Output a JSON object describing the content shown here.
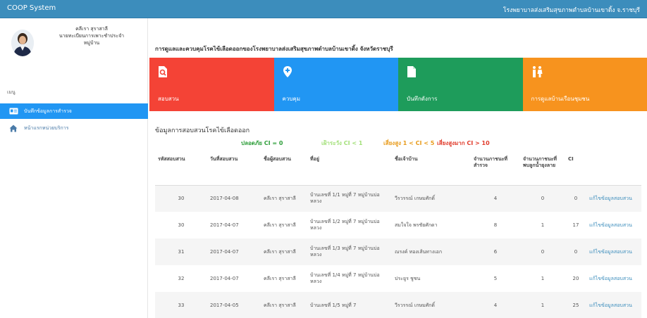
{
  "topbar": {
    "brand": "COOP System",
    "org_name": "โรงพยาบาลส่งเสริมสุขภาพตำบลบ้านเขาดิ้ง จ.ราชบุรี"
  },
  "sidebar": {
    "user": {
      "name": "คลีเรา สุราสาลี",
      "role_line1": "นายทะเบียนการเพาะชำประจำ",
      "role_line2": "หมู่บ้าน"
    },
    "menu_header": "เมนู",
    "items": [
      {
        "label": "บันทึกข้อมูลการสำรวจ",
        "icon": "id-card-icon",
        "active": true
      },
      {
        "label": "หน้าแรกหน่วยบริการ",
        "icon": "home-icon",
        "active": false
      }
    ]
  },
  "main": {
    "page_title": "การดูแลและควบคุมโรคไข้เลือดออกของโรงพยาบาลส่งเสริมสุขภาพตำบลบ้านเขาดิ้ง จังหวัดราชบุรี",
    "cards": [
      {
        "label": "สอบสวน",
        "color": "#f44336",
        "icon": "search-document-icon"
      },
      {
        "label": "ควบคุม",
        "color": "#2196f3",
        "icon": "map-pin-plus-icon"
      },
      {
        "label": "บันทึกดังการ",
        "color": "#1e9c5b",
        "icon": "document-icon"
      },
      {
        "label": "การดูแลบ้านเรือนชุมชน",
        "color": "#f7931e",
        "icon": "people-icon"
      }
    ],
    "section_title": "ข้อมูลการสอบสวนโรคไข้เลือดออก",
    "legend": [
      {
        "text": "ปลอดภัย CI = 0",
        "color": "#2e9e3a"
      },
      {
        "text": "เฝ้าระวัง CI < 1",
        "color": "#a3e07a"
      },
      {
        "text": "เสี่ยงสูง 1 < CI < 5",
        "color": "#e89b1a"
      },
      {
        "text": "เสี่ยงสูงมาก CI > 10",
        "color": "#e03a2a"
      }
    ],
    "table": {
      "headers": [
        "รหัสสอบสวน",
        "วันที่สอบสวน",
        "ชื่อผู้สอบสวน",
        "ที่อยู่",
        "ชื่อเจ้าบ้าน",
        "จำนวนภาชนะที่สำรวจ",
        "จำนวนภาชนะที่พบลูกน้ำยุงลาย",
        "CI",
        ""
      ],
      "rows": [
        [
          "30",
          "2017-04-08",
          "คลีเรา สุราสาลี",
          "บ้านเลขที่ 1/1 หมู่ที่ 7 หมู่บ้านบ่อหลวง",
          "วีรวรรณ์ เกษมศักดิ์",
          "4",
          "0",
          "0",
          "แก้ไขข้อมูลสอบสวน"
        ],
        [
          "30",
          "2017-04-07",
          "คลีเรา สุราสาลี",
          "บ้านเลขที่ 1/2 หมู่ที่ 7 หมู่บ้านบ่อหลวง",
          "สมใจใจ พรชัยศักดา",
          "8",
          "1",
          "17",
          "แก้ไขข้อมูลสอบสวน"
        ],
        [
          "31",
          "2017-04-07",
          "คลีเรา สุราสาลี",
          "บ้านเลขที่ 1/3 หมู่ที่ 7 หมู่บ้านบ่อหลวง",
          "ณรงค์ ทองเส้นทางเอก",
          "6",
          "0",
          "0",
          "แก้ไขข้อมูลสอบสวน"
        ],
        [
          "32",
          "2017-04-07",
          "คลีเรา สุราสาลี",
          "บ้านเลขที่ 1/4 หมู่ที่ 7 หมู่บ้านบ่อหลวง",
          "ประยูร ชูชน",
          "5",
          "1",
          "20",
          "แก้ไขข้อมูลสอบสวน"
        ],
        [
          "33",
          "2017-04-05",
          "คลีเรา สุราสาลี",
          "บ้านเลขที่ 1/5 หมู่ที่ 7",
          "วีรวรรณ์ เกษมศักดิ์",
          "4",
          "1",
          "25",
          "แก้ไขข้อมูลสอบสวน"
        ]
      ]
    }
  }
}
